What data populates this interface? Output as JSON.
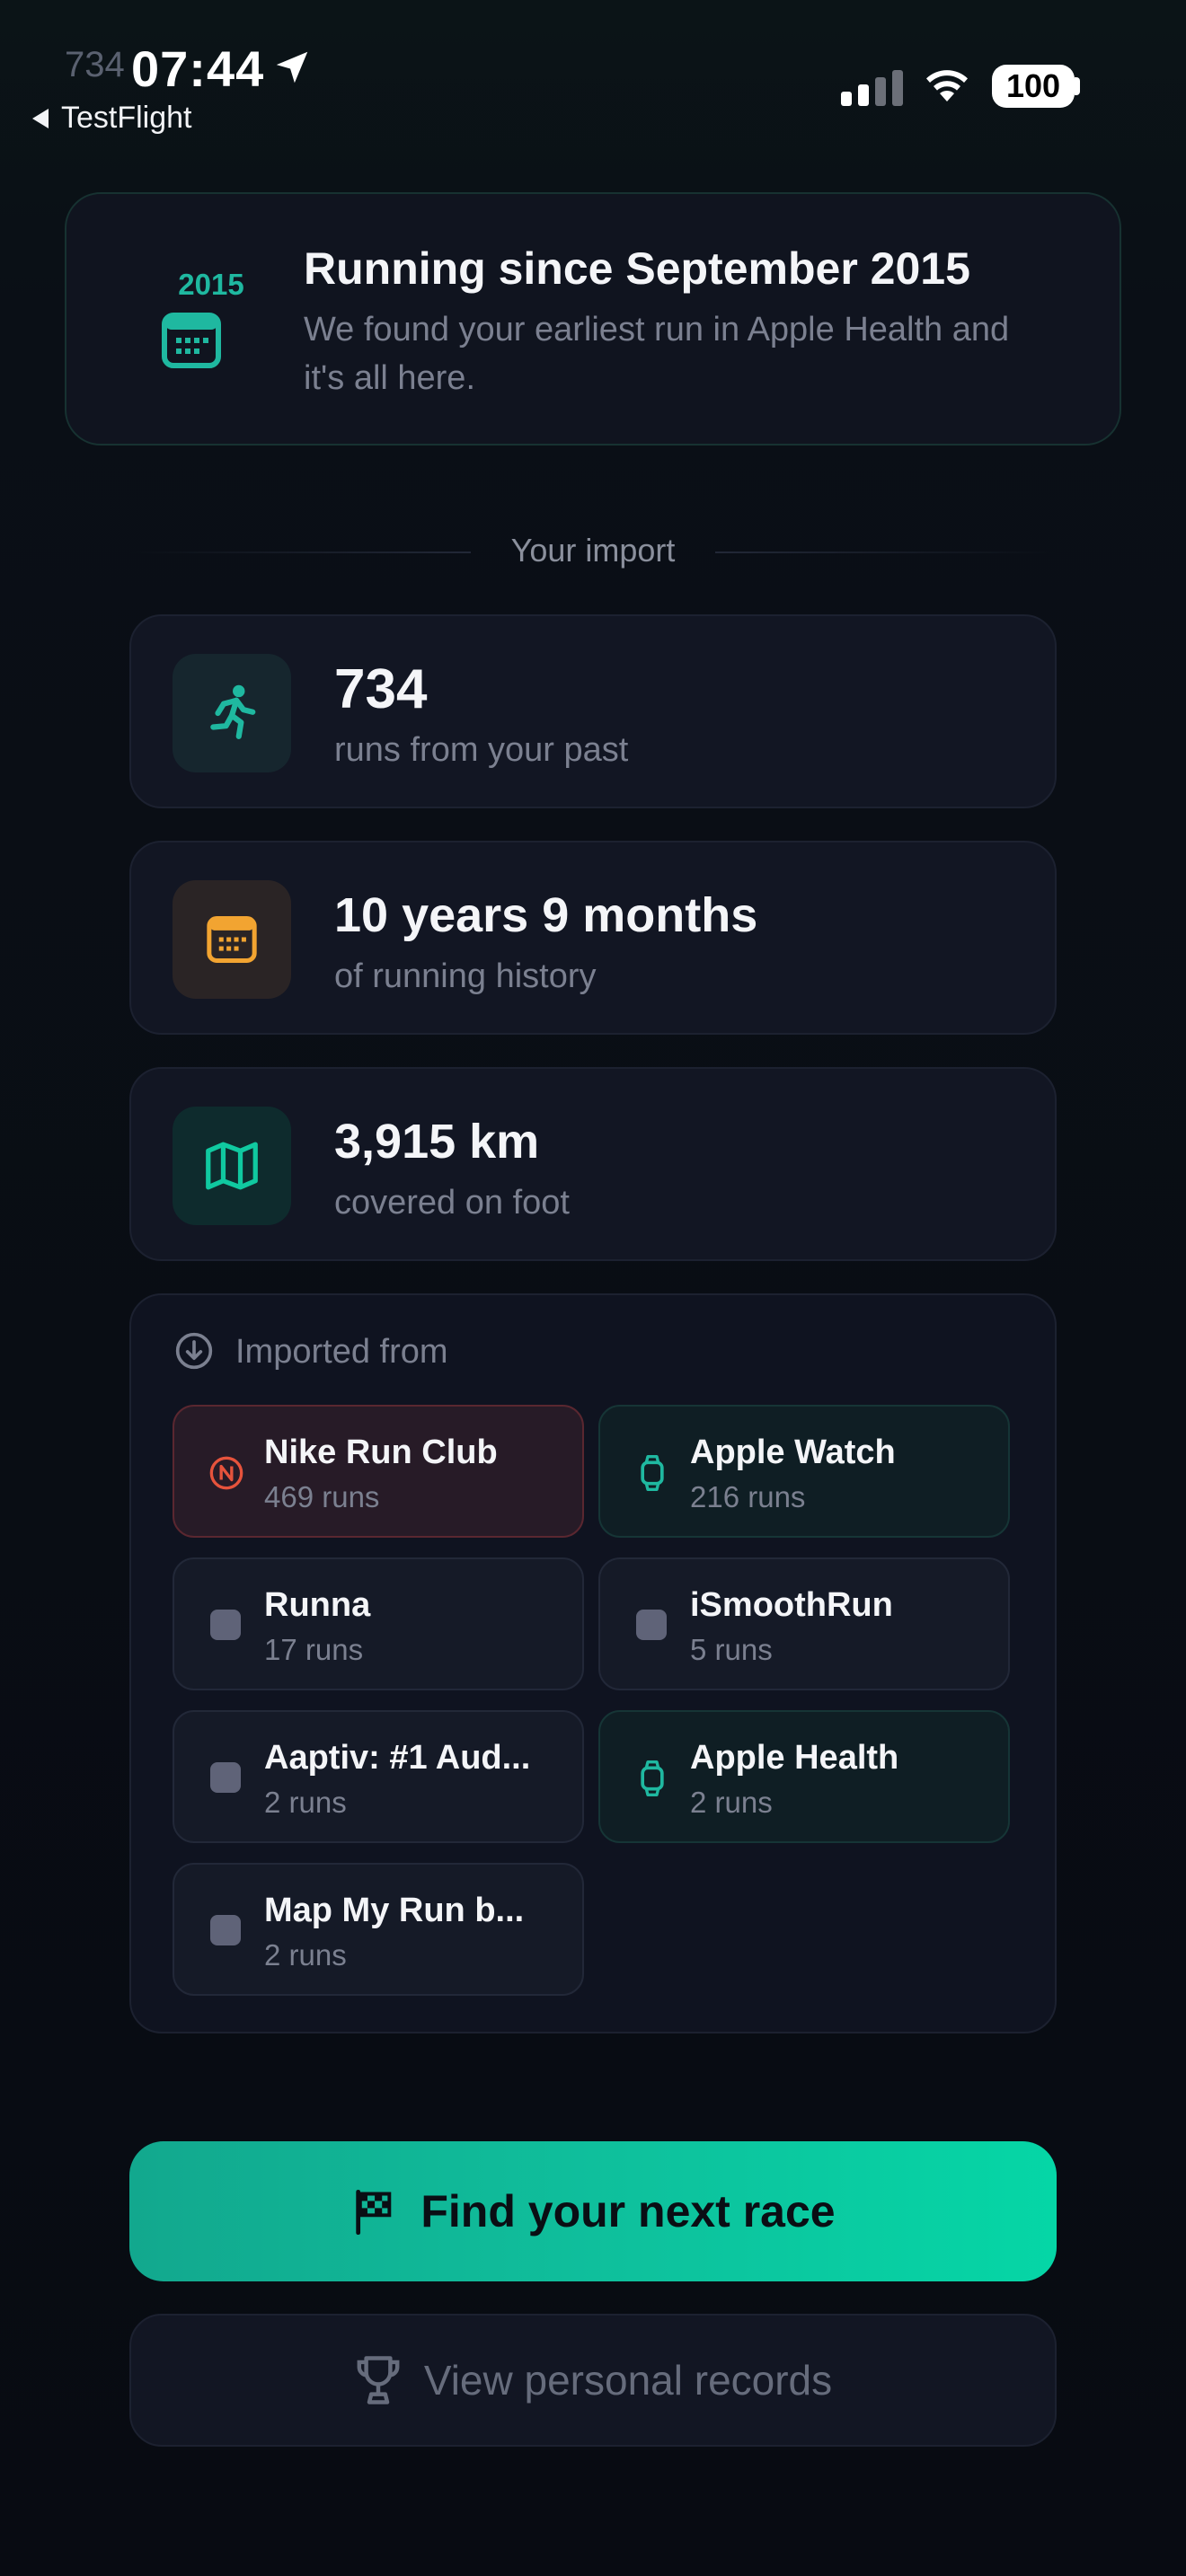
{
  "status_bar": {
    "ghost_text": "734",
    "time": "07:44",
    "back_label": "TestFlight",
    "battery": "100"
  },
  "hero": {
    "year": "2015",
    "title": "Running since September 2015",
    "subtitle": "We found your earliest run in Apple Health and it's all here."
  },
  "section_label": "Your import",
  "stats": [
    {
      "value": "734",
      "label": "runs from your past",
      "icon": "runner-icon"
    },
    {
      "value": "10 years 9 months",
      "label": "of running history",
      "icon": "calendar-icon"
    },
    {
      "value": "3,915 km",
      "label": "covered on foot",
      "icon": "map-icon"
    }
  ],
  "sources": {
    "heading": "Imported from",
    "items": [
      {
        "name": "Nike Run Club",
        "runs": "469 runs",
        "icon": "nike-icon"
      },
      {
        "name": "Apple Watch",
        "runs": "216 runs",
        "icon": "watch-icon"
      },
      {
        "name": "Runna",
        "runs": "17 runs",
        "icon": "app-placeholder-icon"
      },
      {
        "name": "iSmoothRun",
        "runs": "5 runs",
        "icon": "app-placeholder-icon"
      },
      {
        "name": "Aaptiv: #1 Aud...",
        "runs": "2 runs",
        "icon": "app-placeholder-icon"
      },
      {
        "name": "Apple Health",
        "runs": "2 runs",
        "icon": "watch-icon"
      },
      {
        "name": "Map My Run b...",
        "runs": "2 runs",
        "icon": "app-placeholder-icon"
      }
    ]
  },
  "actions": {
    "primary_label": "Find your next race",
    "secondary_label": "View personal records"
  },
  "colors": {
    "accent": "#0fbf9c",
    "calendar_orange": "#f2a431",
    "nike_red": "#e6533c",
    "muted_text": "#7b8090"
  }
}
